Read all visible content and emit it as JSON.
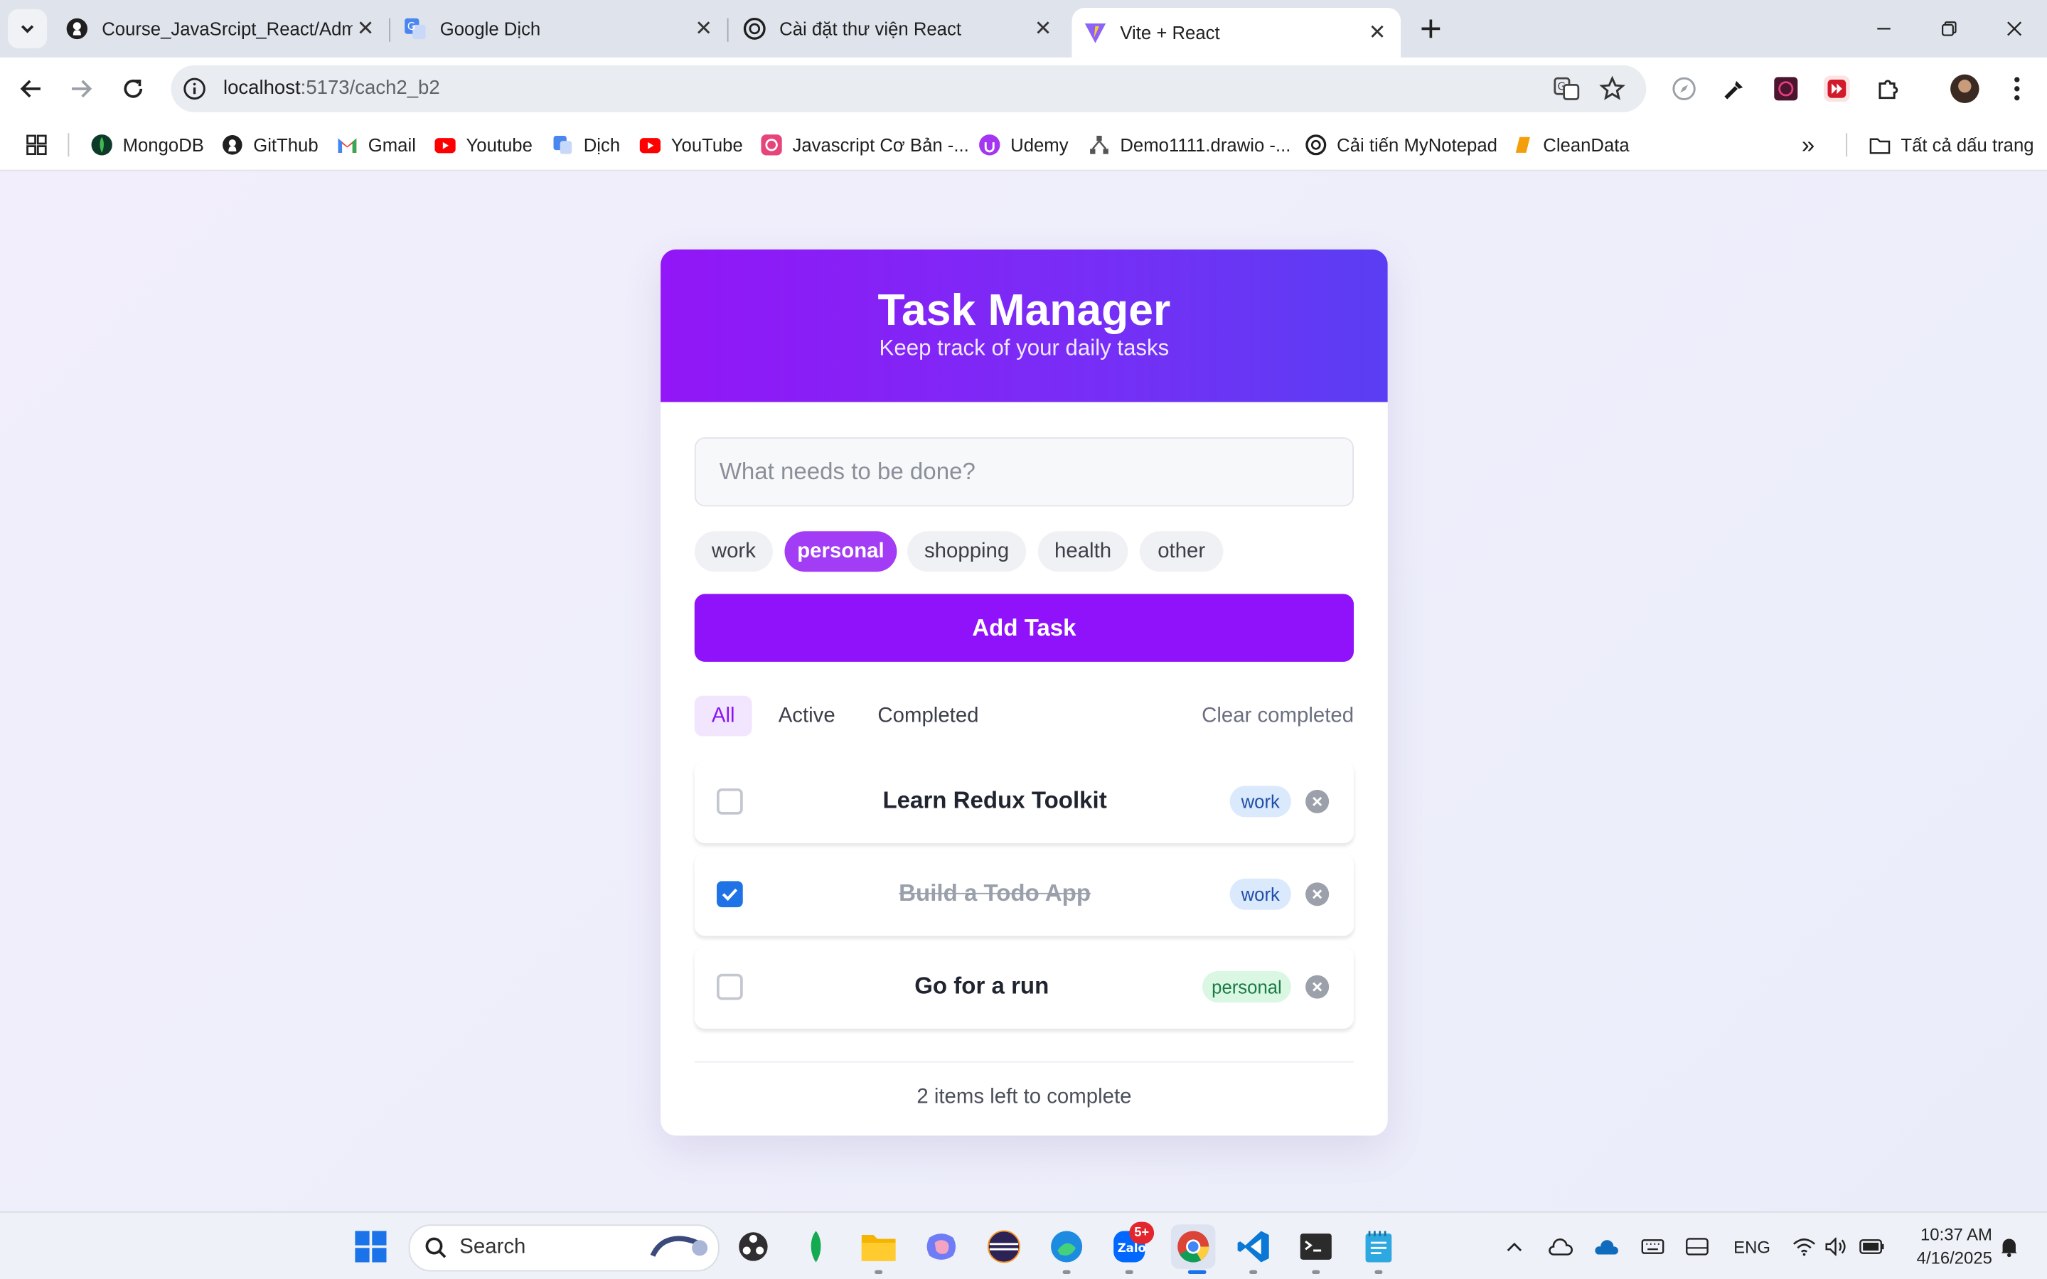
{
  "browser": {
    "tabs": [
      {
        "title": "Course_JavaSrcipt_React/Admin",
        "icon": "github-icon"
      },
      {
        "title": "Google Dịch",
        "icon": "google-translate-icon"
      },
      {
        "title": "Cài đặt thư viện React",
        "icon": "openai-icon"
      },
      {
        "title": "Vite + React",
        "icon": "vite-icon",
        "active": true
      }
    ],
    "url_host": "localhost",
    "url_path": ":5173/cach2_b2",
    "bookmarks": [
      {
        "label": "MongoDB",
        "icon": "mongodb-icon"
      },
      {
        "label": "GitThub",
        "icon": "github-icon"
      },
      {
        "label": "Gmail",
        "icon": "gmail-icon"
      },
      {
        "label": "Youtube",
        "icon": "youtube-icon"
      },
      {
        "label": "Dịch",
        "icon": "google-translate-icon"
      },
      {
        "label": "YouTube",
        "icon": "youtube-icon"
      },
      {
        "label": "Javascript Cơ Bản -...",
        "icon": "bookmark-icon"
      },
      {
        "label": "Udemy",
        "icon": "udemy-icon"
      },
      {
        "label": "Demo1111.drawio -...",
        "icon": "drawio-icon"
      },
      {
        "label": "Cải tiến MyNotepad",
        "icon": "openai-icon"
      },
      {
        "label": "CleanData",
        "icon": "bookmark-icon"
      }
    ],
    "all_bookmarks_label": "Tất cả dấu trang"
  },
  "app": {
    "title": "Task Manager",
    "subtitle": "Keep track of your daily tasks",
    "input_placeholder": "What needs to be done?",
    "categories": [
      "work",
      "personal",
      "shopping",
      "health",
      "other"
    ],
    "selected_category": "personal",
    "add_button": "Add Task",
    "filters": [
      "All",
      "Active",
      "Completed"
    ],
    "selected_filter": "All",
    "clear_completed": "Clear completed",
    "todos": [
      {
        "text": "Learn Redux Toolkit",
        "category": "work",
        "completed": false
      },
      {
        "text": "Build a Todo App",
        "category": "work",
        "completed": true
      },
      {
        "text": "Go for a run",
        "category": "personal",
        "completed": false
      }
    ],
    "footer": "2 items left to complete"
  },
  "taskbar": {
    "search_label": "Search",
    "language": "ENG",
    "time": "10:37 AM",
    "date": "4/16/2025",
    "zalo_badge": "5+"
  },
  "colors": {
    "accent": "#9012fb",
    "header_gradient_start": "#9216f7",
    "header_gradient_end": "#5a3ef3",
    "checkbox_checked": "#1f73e6"
  }
}
